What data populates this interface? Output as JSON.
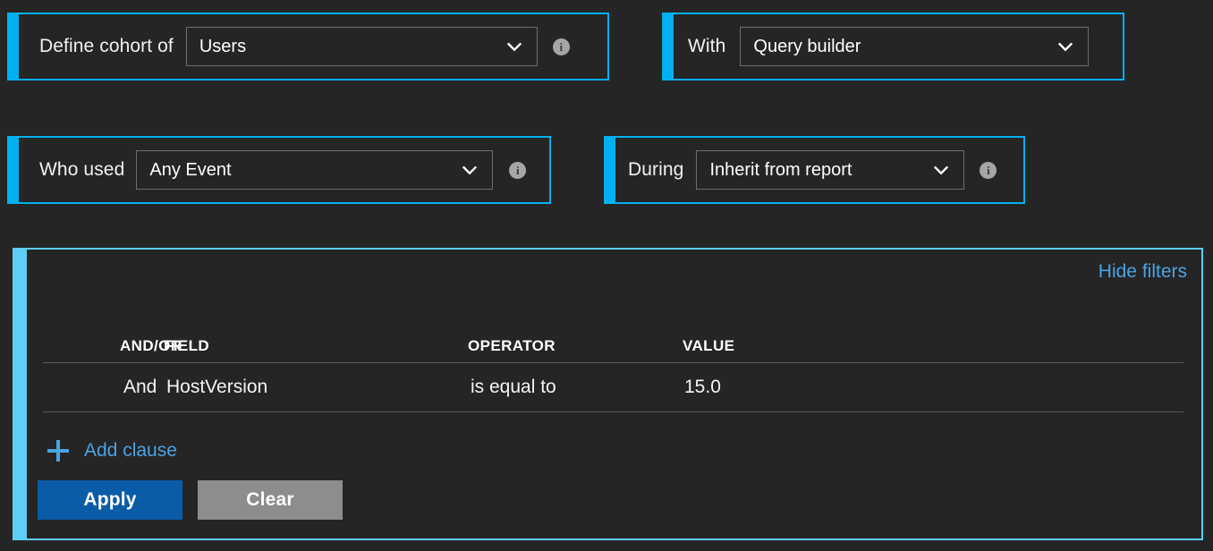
{
  "theme": {
    "background": "#252525",
    "accent_blue": "#00b0f0",
    "accent_blue_light": "#5ecef5",
    "link_blue": "#4ba3e3",
    "apply_button": "#0a5ca8",
    "clear_button": "#8d8d8d",
    "select_border": "#6d6d6d"
  },
  "row1": {
    "cohort": {
      "label": "Define cohort of",
      "select_value": "Users",
      "info_char": "i"
    },
    "with": {
      "label": "With",
      "select_value": "Query builder"
    }
  },
  "row2": {
    "who_used": {
      "label": "Who used",
      "select_value": "Any Event",
      "info_char": "i"
    },
    "during": {
      "label": "During",
      "select_value": "Inherit from report",
      "info_char": "i"
    }
  },
  "filters": {
    "hide_filters_label": "Hide filters",
    "columns": [
      "AND/OR",
      "FIELD",
      "OPERATOR",
      "VALUE"
    ],
    "rows": [
      {
        "andor": "And",
        "field": "HostVersion",
        "operator": "is equal to",
        "value": "15.0"
      }
    ],
    "add_clause_label": "Add clause",
    "apply_label": "Apply",
    "clear_label": "Clear"
  }
}
